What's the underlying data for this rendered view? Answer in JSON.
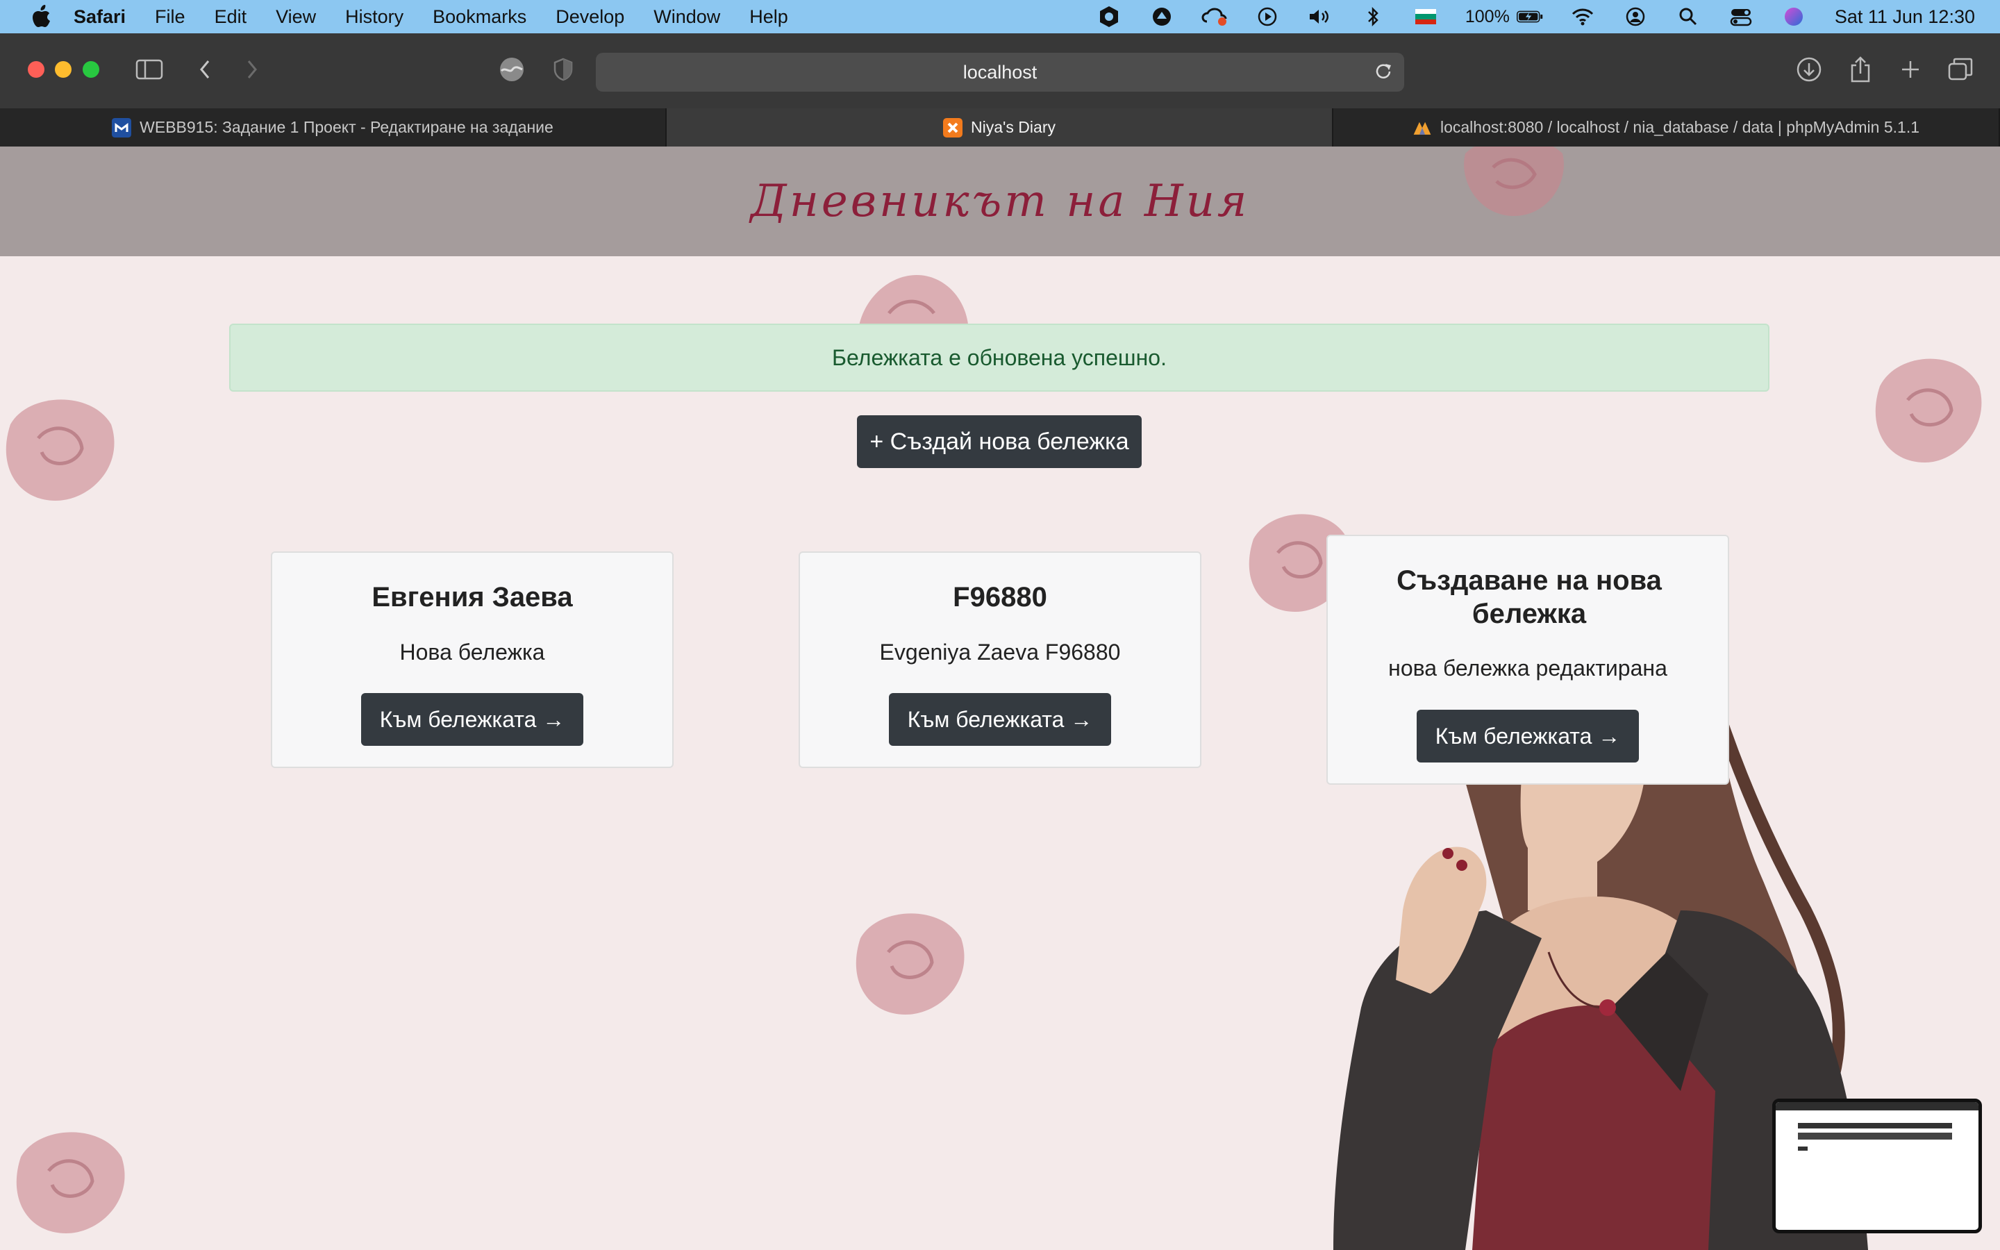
{
  "menubar": {
    "app_name": "Safari",
    "items": [
      "File",
      "Edit",
      "View",
      "History",
      "Bookmarks",
      "Develop",
      "Window",
      "Help"
    ],
    "battery": "100%",
    "clock": "Sat 11 Jun  12:30"
  },
  "browser": {
    "address": "localhost",
    "tabs": [
      {
        "label": "WEBB915: Задание 1 Проект - Редактиране на задание",
        "active": false
      },
      {
        "label": "Niya's Diary",
        "active": true
      },
      {
        "label": "localhost:8080 / localhost / nia_database / data | phpMyAdmin 5.1.1",
        "active": false
      }
    ]
  },
  "site": {
    "title": "Дневникът на Ния",
    "alert": "Бележката е обновена успешно.",
    "create_button": "+ Създай нова бележка"
  },
  "cards": [
    {
      "title": "Евгения Заева",
      "description": "Нова бележка",
      "button": "Към бележката →"
    },
    {
      "title": "F96880",
      "description": "Evgeniya Zaeva F96880",
      "button": "Към бележката →"
    },
    {
      "title": "Създаване на нова бележка",
      "description": "нова бележка редактирана",
      "button": "Към бележката →"
    }
  ],
  "colors": {
    "menubar": "#8cc7f1",
    "header": "#a59c9c",
    "title": "#8c1f3a",
    "page_bg": "#f4eaea",
    "alert_bg": "#d4ebd9",
    "button": "#343a40"
  }
}
